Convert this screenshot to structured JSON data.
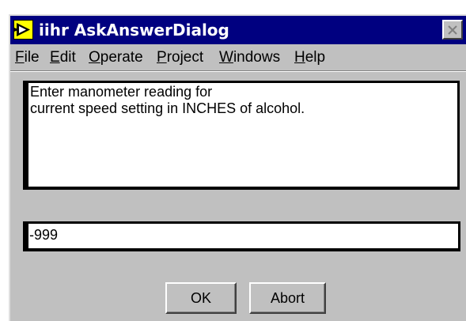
{
  "window": {
    "title": "iihr AskAnswerDialog",
    "icon": "labview-run-arrow-icon"
  },
  "menu": {
    "items": [
      {
        "label": "File",
        "mnemonic": "F"
      },
      {
        "label": "Edit",
        "mnemonic": "E"
      },
      {
        "label": "Operate",
        "mnemonic": "O"
      },
      {
        "label": "Project",
        "mnemonic": "P"
      },
      {
        "label": "Windows",
        "mnemonic": "W"
      },
      {
        "label": "Help",
        "mnemonic": "H"
      }
    ]
  },
  "dialog": {
    "message_lines": [
      "Enter manometer reading for",
      "current speed setting in INCHES of alcohol."
    ],
    "answer_value": "-999",
    "ok_label": "OK",
    "abort_label": "Abort"
  },
  "colors": {
    "title_bar": "#000080",
    "face": "#c0c0c0"
  }
}
